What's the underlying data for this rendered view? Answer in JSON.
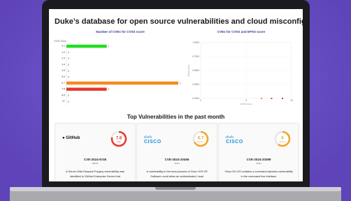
{
  "page": {
    "title": "Duke’s database for open source vulnerabilities and cloud misconfigurations",
    "section_title": "Top Vulnerabilities in the past month"
  },
  "colors": {
    "background": "#6b4fc8",
    "bar_green": "#22dd22",
    "bar_orange": "#f58a1f",
    "bar_red": "#e63a2a",
    "chart_title": "#2a3a8c",
    "scatter_orange": "#f58a1f",
    "scatter_red": "#d63a7a"
  },
  "chart_data": [
    {
      "type": "bar",
      "orientation": "horizontal",
      "title": "Number of CVEs for CVSS score",
      "ylabel": "CVSS Score",
      "categories": [
        "9-1",
        "1-2",
        "2-3",
        "3-4",
        "4-5",
        "5-6",
        "6-7",
        "7-8",
        "8-9",
        "9+"
      ],
      "values": [
        1,
        0,
        0,
        0,
        0,
        0,
        1,
        1,
        0,
        0
      ],
      "value_labels": [
        "1",
        "0",
        "0",
        "0",
        "0",
        "0",
        "1",
        "1",
        "0",
        "0"
      ],
      "bar_colors": [
        "#22dd22",
        "",
        "",
        "",
        "",
        "",
        "#f58a1f",
        "#e63a2a",
        "",
        ""
      ],
      "bar_lengths_relative": [
        0.36,
        0,
        0,
        0,
        0,
        0,
        1.0,
        0.36,
        0,
        0
      ]
    },
    {
      "type": "scatter",
      "title": "CVEs for CVSS and EPSS score",
      "xlabel": "CVSS Score",
      "ylabel": "EPSS Score",
      "y_ticks": [
        "1.0000",
        "0.7500",
        "0.5000",
        "0.2500",
        "0.0000"
      ],
      "x_ticks": [
        "0",
        "5",
        "10"
      ],
      "ylim": [
        0,
        1
      ],
      "xlim": [
        0,
        10
      ],
      "points": [
        {
          "x": 6.7,
          "y": 0.0,
          "color": "#f58a1f"
        },
        {
          "x": 7.8,
          "y": 0.0,
          "color": "#d63a7a"
        },
        {
          "x": 9.0,
          "y": 0.0,
          "color": "#d63a7a"
        }
      ]
    }
  ],
  "cards": [
    {
      "logo": "GitHub",
      "score": "7.8",
      "severity": "High",
      "score_color": "#e63a2a",
      "score_fraction": 0.78,
      "cve": "CVE-2024-5746",
      "vendor": "Github",
      "description": "A Server-Side Request Forgery vulnerability was identified in GitHub Enterprise Server that"
    },
    {
      "logo": "CISCO",
      "score": "6.7",
      "severity": "Medium",
      "score_color": "#f2a52a",
      "score_fraction": 0.67,
      "cve": "CVE-2024-20456",
      "vendor": "Cisco",
      "description": "A vulnerability in the boot process of Cisco IOS XR Software could allow an authenticated, local"
    },
    {
      "logo": "CISCO",
      "score": "6",
      "severity": "Medium",
      "score_color": "#f2a52a",
      "score_fraction": 0.6,
      "cve": "CVE-2024-20399",
      "vendor": "Cisco",
      "description": "Cisco NX-OS contains a command injection vulnerability in the command line interface"
    }
  ]
}
